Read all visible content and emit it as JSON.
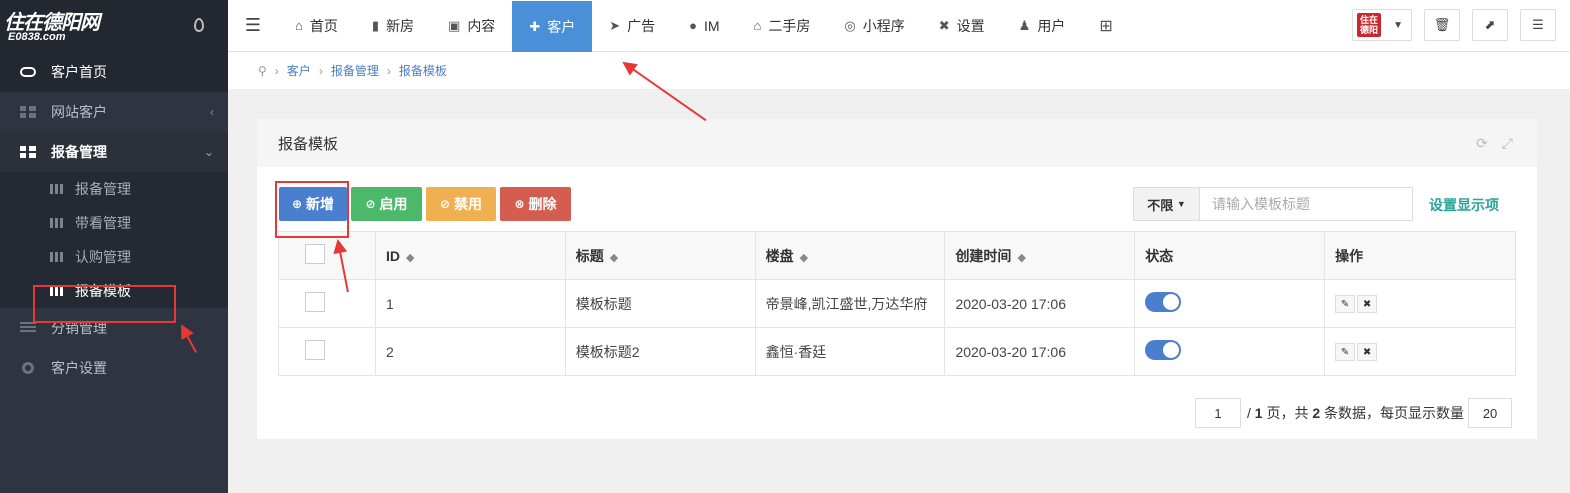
{
  "logo": {
    "brand": "住在德阳网",
    "sub": "E0838.com"
  },
  "sidebar": {
    "items": [
      {
        "label": "客户首页"
      },
      {
        "label": "网站客户"
      },
      {
        "label": "报备管理"
      },
      {
        "label": "分销管理"
      },
      {
        "label": "客户设置"
      }
    ],
    "sub_items": [
      {
        "label": "报备管理"
      },
      {
        "label": "带看管理"
      },
      {
        "label": "认购管理"
      },
      {
        "label": "报备模板"
      }
    ]
  },
  "topnav": {
    "items": [
      {
        "label": "首页",
        "icon": "home-icon"
      },
      {
        "label": "新房",
        "icon": "building-icon"
      },
      {
        "label": "内容",
        "icon": "content-icon"
      },
      {
        "label": "客户",
        "icon": "user-add-icon"
      },
      {
        "label": "广告",
        "icon": "send-icon"
      },
      {
        "label": "IM",
        "icon": "chat-icon"
      },
      {
        "label": "二手房",
        "icon": "home-icon"
      },
      {
        "label": "小程序",
        "icon": "miniapp-icon"
      },
      {
        "label": "设置",
        "icon": "settings-icon"
      },
      {
        "label": "用户",
        "icon": "user-icon"
      }
    ],
    "mini_logo": "住在德阳"
  },
  "breadcrumb": [
    "客户",
    "报备管理",
    "报备模板"
  ],
  "card": {
    "title": "报备模板"
  },
  "toolbar": {
    "add": "新增",
    "enable": "启用",
    "disable": "禁用",
    "delete": "删除",
    "filter_select": "不限",
    "search_placeholder": "请输入模板标题",
    "columns_link": "设置显示项"
  },
  "table": {
    "headers": [
      "ID",
      "标题",
      "楼盘",
      "创建时间",
      "状态",
      "操作"
    ],
    "rows": [
      {
        "id": "1",
        "title": "模板标题",
        "estate": "帝景峰,凯江盛世,万达华府",
        "created": "2020-03-20 17:06",
        "status": true
      },
      {
        "id": "2",
        "title": "模板标题2",
        "estate": "鑫恒·香廷",
        "created": "2020-03-20 17:06",
        "status": true
      }
    ]
  },
  "pager": {
    "page": "1",
    "total_pages": "1",
    "text_page": "页，共",
    "total_records": "2",
    "text_records": "条数据，每页显示数量",
    "page_size": "20"
  },
  "colors": {
    "accent": "#4a7fcf",
    "sidebar": "#2f3540",
    "success": "#4cb86a",
    "warning": "#f0b052",
    "danger": "#d35d4e",
    "annotation": "#e53935"
  }
}
